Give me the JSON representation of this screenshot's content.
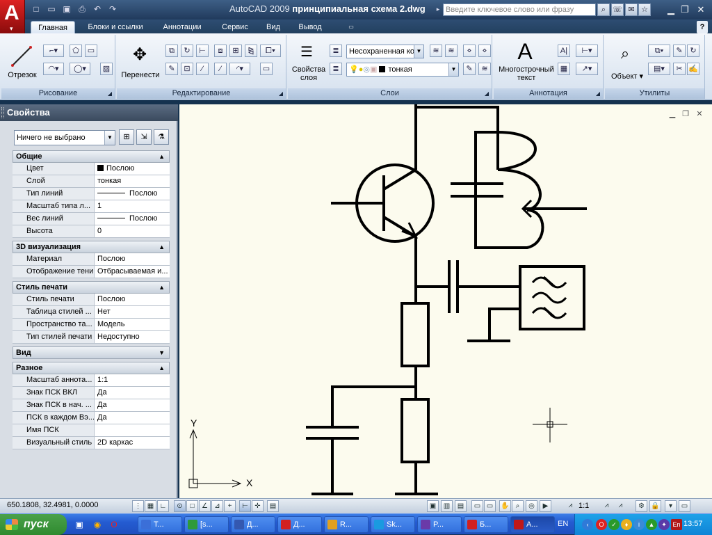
{
  "app": {
    "name": "AutoCAD 2009",
    "file": "принципиальная схема 2.dwg",
    "search_placeholder": "Введите ключевое слово или фразу"
  },
  "ribbon": {
    "tabs": [
      "Главная",
      "Блоки и ссылки",
      "Аннотации",
      "Сервис",
      "Вид",
      "Вывод"
    ],
    "panels": {
      "draw": "Рисование",
      "modify": "Редактирование",
      "layers": "Слои",
      "annotation": "Аннотация",
      "utilities": "Утилиты"
    },
    "buttons": {
      "line": "Отрезок",
      "move": "Перенести",
      "layer_props_1": "Свойства",
      "layer_props_2": "слоя",
      "mtext_1": "Многострочный",
      "mtext_2": "текст",
      "object": "Объект"
    },
    "layer_state": "Несохраненная ко",
    "layer_current": "тонкая"
  },
  "properties": {
    "title": "Свойства",
    "selection": "Ничего не выбрано",
    "sections": [
      {
        "name": "Общие",
        "expanded": true,
        "rows": [
          {
            "k": "Цвет",
            "v": "Послою",
            "kind": "color"
          },
          {
            "k": "Слой",
            "v": "тонкая"
          },
          {
            "k": "Тип линий",
            "v": "Послою",
            "kind": "line"
          },
          {
            "k": "Масштаб типа л...",
            "v": "1"
          },
          {
            "k": "Вес линий",
            "v": "Послою",
            "kind": "line"
          },
          {
            "k": "Высота",
            "v": "0"
          }
        ]
      },
      {
        "name": "3D визуализация",
        "expanded": true,
        "rows": [
          {
            "k": "Материал",
            "v": "Послою"
          },
          {
            "k": "Отображение тени",
            "v": "Отбрасываемая и..."
          }
        ]
      },
      {
        "name": "Стиль печати",
        "expanded": true,
        "rows": [
          {
            "k": "Стиль печати",
            "v": "Послою"
          },
          {
            "k": "Таблица стилей ...",
            "v": "Нет"
          },
          {
            "k": "Пространство та...",
            "v": "Модель"
          },
          {
            "k": "Тип стилей печати",
            "v": "Недоступно"
          }
        ]
      },
      {
        "name": "Вид",
        "expanded": false,
        "rows": []
      },
      {
        "name": "Разное",
        "expanded": true,
        "rows": [
          {
            "k": "Масштаб аннота...",
            "v": "1:1"
          },
          {
            "k": "Знак ПСК ВКЛ",
            "v": "Да"
          },
          {
            "k": "Знак ПСК в нач. ...",
            "v": "Да"
          },
          {
            "k": "ПСК в каждом Вэ...",
            "v": "Да"
          },
          {
            "k": "Имя ПСК",
            "v": ""
          },
          {
            "k": "Визуальный стиль",
            "v": "2D каркас"
          }
        ]
      }
    ]
  },
  "ucs": {
    "x": "X",
    "y": "Y"
  },
  "status": {
    "coords": "650.1808, 32.4981, 0.0000",
    "scale": "1:1"
  },
  "taskbar": {
    "start": "пуск",
    "tasks": [
      {
        "label": "T...",
        "color": "#3b6fd8"
      },
      {
        "label": "[s...",
        "color": "#2f9a3a"
      },
      {
        "label": "Д...",
        "color": "#3458b0"
      },
      {
        "label": "Д...",
        "color": "#d22020"
      },
      {
        "label": "R...",
        "color": "#e0a020"
      },
      {
        "label": "Sk...",
        "color": "#1a9ae0"
      },
      {
        "label": "P...",
        "color": "#6a3aa8"
      },
      {
        "label": "Б...",
        "color": "#d22020"
      },
      {
        "label": "A...",
        "color": "#c01818"
      }
    ],
    "lang": "EN",
    "clock": "13:57"
  },
  "colors": {
    "canvas": "#fcfbee",
    "accent": "#c01818"
  }
}
